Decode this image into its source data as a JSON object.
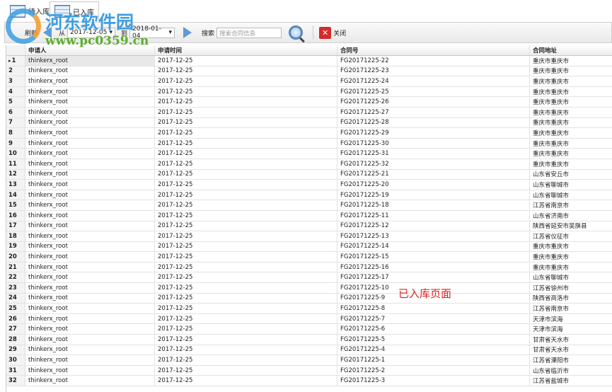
{
  "tabs": [
    {
      "label": "待入库"
    },
    {
      "label": "已入库"
    }
  ],
  "toolbar": {
    "refresh": "刷新",
    "from": "从",
    "from_date": "2017-12-05",
    "to": "到",
    "to_date": "2018-01-04",
    "search_label": "搜索",
    "search_placeholder": "搜索合同信息",
    "close": "关闭"
  },
  "columns": [
    "申请人",
    "申请时间",
    "合同号",
    "合同地址"
  ],
  "rows": [
    [
      "1",
      "thinkerx_root",
      "2017-12-25",
      "FG20171225-22",
      "重庆市重庆市"
    ],
    [
      "2",
      "thinkerx_root",
      "2017-12-25",
      "FG20171225-23",
      "重庆市重庆市"
    ],
    [
      "3",
      "thinkerx_root",
      "2017-12-25",
      "FG20171225-24",
      "重庆市重庆市"
    ],
    [
      "4",
      "thinkerx_root",
      "2017-12-25",
      "FG20171225-25",
      "重庆市重庆市"
    ],
    [
      "5",
      "thinkerx_root",
      "2017-12-25",
      "FG20171225-26",
      "重庆市重庆市"
    ],
    [
      "6",
      "thinkerx_root",
      "2017-12-25",
      "FG20171225-27",
      "重庆市重庆市"
    ],
    [
      "7",
      "thinkerx_root",
      "2017-12-25",
      "FG20171225-28",
      "重庆市重庆市"
    ],
    [
      "8",
      "thinkerx_root",
      "2017-12-25",
      "FG20171225-29",
      "重庆市重庆市"
    ],
    [
      "9",
      "thinkerx_root",
      "2017-12-25",
      "FG20171225-30",
      "重庆市重庆市"
    ],
    [
      "10",
      "thinkerx_root",
      "2017-12-25",
      "FG20171225-31",
      "重庆市重庆市"
    ],
    [
      "11",
      "thinkerx_root",
      "2017-12-25",
      "FG20171225-32",
      "重庆市重庆市"
    ],
    [
      "12",
      "thinkerx_root",
      "2017-12-25",
      "FG20171225-21",
      "山东省安丘市"
    ],
    [
      "13",
      "thinkerx_root",
      "2017-12-25",
      "FG20171225-20",
      "山东省聊城市"
    ],
    [
      "14",
      "thinkerx_root",
      "2017-12-25",
      "FG20171225-19",
      "山东省聊城市"
    ],
    [
      "15",
      "thinkerx_root",
      "2017-12-25",
      "FG20171225-18",
      "江苏省南京市"
    ],
    [
      "16",
      "thinkerx_root",
      "2017-12-25",
      "FG20171225-11",
      "山东省济南市"
    ],
    [
      "17",
      "thinkerx_root",
      "2017-12-25",
      "FG20171225-12",
      "陕西省延安市吴旗县"
    ],
    [
      "18",
      "thinkerx_root",
      "2017-12-25",
      "FG20171225-13",
      "江苏省仪征市"
    ],
    [
      "19",
      "thinkerx_root",
      "2017-12-25",
      "FG20171225-14",
      "重庆市重庆市"
    ],
    [
      "20",
      "thinkerx_root",
      "2017-12-25",
      "FG20171225-15",
      "重庆市重庆市"
    ],
    [
      "21",
      "thinkerx_root",
      "2017-12-25",
      "FG20171225-16",
      "重庆市重庆市"
    ],
    [
      "22",
      "thinkerx_root",
      "2017-12-25",
      "FG20171225-17",
      "山东省聊城市"
    ],
    [
      "23",
      "thinkerx_root",
      "2017-12-25",
      "FG20171225-10",
      "江苏省徐州市"
    ],
    [
      "24",
      "thinkerx_root",
      "2017-12-25",
      "FG20171225-9",
      "陕西省商洛市"
    ],
    [
      "25",
      "thinkerx_root",
      "2017-12-25",
      "FG20171225-8",
      "江苏省南京市"
    ],
    [
      "26",
      "thinkerx_root",
      "2017-12-25",
      "FG20171225-7",
      "天津市滨海"
    ],
    [
      "27",
      "thinkerx_root",
      "2017-12-25",
      "FG20171225-6",
      "天津市滨海"
    ],
    [
      "28",
      "thinkerx_root",
      "2017-12-25",
      "FG20171225-5",
      "甘肃省天水市"
    ],
    [
      "29",
      "thinkerx_root",
      "2017-12-25",
      "FG20171225-4",
      "甘肃省天水市"
    ],
    [
      "30",
      "thinkerx_root",
      "2017-12-25",
      "FG20171225-1",
      "江苏省溧阳市"
    ],
    [
      "31",
      "thinkerx_root",
      "2017-12-25",
      "FG20171225-2",
      "山东省临沂市"
    ],
    [
      "32",
      "thinkerx_root",
      "2017-12-25",
      "FG20171225-3",
      "江苏省盐城市"
    ]
  ],
  "watermark": {
    "name": "河东软件园",
    "url": "www.pc0359.cn"
  },
  "annotation": "已入库页面"
}
